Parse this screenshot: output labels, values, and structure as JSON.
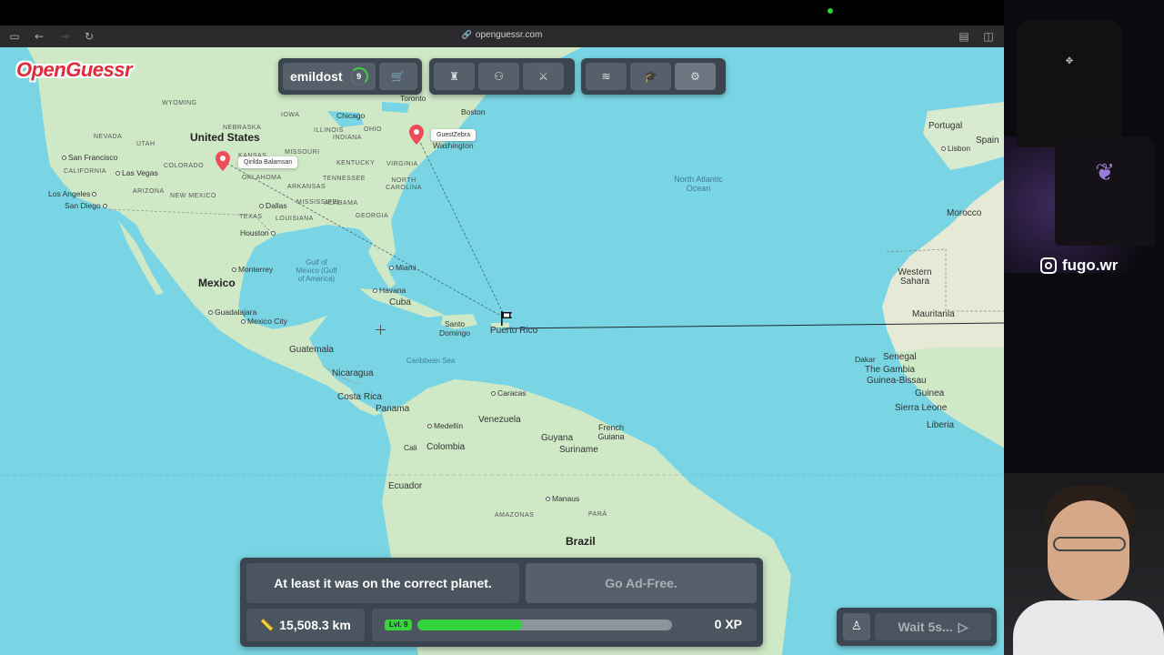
{
  "browser": {
    "url": "openguessr.com"
  },
  "logo": "OpenGuessr",
  "topbar": {
    "username": "emildost",
    "level": "9"
  },
  "map": {
    "countries": [
      "United States",
      "Mexico",
      "Cuba",
      "Guatemala",
      "Nicaragua",
      "Costa Rica",
      "Panama",
      "Venezuela",
      "Colombia",
      "Ecuador",
      "Guyana",
      "Suriname",
      "Brazil",
      "Portugal",
      "Spain",
      "Morocco",
      "Western Sahara",
      "Mauritania",
      "Senegal",
      "The Gambia",
      "Guinea-Bissau",
      "Guinea",
      "Sierra Leone",
      "Liberia"
    ],
    "labels": {
      "united_states": "United States",
      "mexico": "Mexico",
      "cuba": "Cuba",
      "guatemala": "Guatemala",
      "nicaragua": "Nicaragua",
      "costa_rica": "Costa Rica",
      "panama": "Panama",
      "venezuela": "Venezuela",
      "colombia": "Colombia",
      "ecuador": "Ecuador",
      "guyana": "Guyana",
      "suriname": "Suriname",
      "french_guiana": "French Guiana",
      "brazil": "Brazil",
      "portugal": "Portugal",
      "spain": "Spain",
      "morocco": "Morocco",
      "western_sahara": "Western Sahara",
      "mauritania": "Mauritania",
      "senegal": "Senegal",
      "gambia": "The Gambia",
      "guinea_bissau": "Guinea-Bissau",
      "guinea": "Guinea",
      "sierra_leone": "Sierra Leone",
      "liberia": "Liberia",
      "puerto_rico": "Puerto Rico",
      "santo_domingo": "Santo Domingo",
      "washington": "Washington",
      "boston": "Boston",
      "toronto": "Toronto",
      "chicago": "Chicago",
      "san_francisco": "San Francisco",
      "las_vegas": "Las Vegas",
      "los_angeles": "Los Angeles",
      "san_diego": "San Diego",
      "dallas": "Dallas",
      "houston": "Houston",
      "monterrey": "Monterrey",
      "guadalajara": "Guadalajara",
      "mexico_city": "Mexico City",
      "miami": "Miami",
      "havana": "Havana",
      "caracas": "Caracas",
      "medellin": "Medellín",
      "cali": "Cali",
      "manaus": "Manaus",
      "lisbon": "Lisbon",
      "dakar": "Dakar",
      "gulf_mexico": "Gulf of Mexico (Gulf of America)",
      "caribbean": "Caribbean Sea",
      "atlantic": "North Atlantic Ocean",
      "nevada": "NEVADA",
      "utah": "UTAH",
      "colorado": "COLORADO",
      "arizona": "ARIZONA",
      "new_mexico": "NEW MEXICO",
      "texas": "TEXAS",
      "oklahoma": "OKLAHOMA",
      "kansas": "KANSAS",
      "nebraska": "NEBRASKA",
      "iowa": "IOWA",
      "missouri": "MISSOURI",
      "illinois": "ILLINOIS",
      "indiana": "INDIANA",
      "ohio": "OHIO",
      "kentucky": "KENTUCKY",
      "tennessee": "TENNESSEE",
      "arkansas": "ARKANSAS",
      "mississippi": "MISSISSIPPI",
      "alabama": "ALABAMA",
      "georgia": "GEORGIA",
      "virginia": "VIRGINIA",
      "north_carolina": "NORTH CAROLINA",
      "louisiana": "LOUISIANA",
      "wyoming": "WYOMING",
      "california": "CALIFORNIA",
      "amazonas": "AMAZONAS",
      "para": "PARÁ"
    },
    "players": [
      {
        "name": "Qirilda Balamsan"
      },
      {
        "name": "GuestZebra"
      }
    ]
  },
  "result": {
    "message": "At least it was on the correct planet.",
    "ad_free": "Go Ad-Free.",
    "distance": "15,508.3 km",
    "level_badge": "Lvl. 9",
    "xp_progress": 0.41,
    "xp": "0 XP"
  },
  "bottom_right": {
    "wait_label": "Wait 5s..."
  },
  "overlay": {
    "instagram": "fugo.wr"
  },
  "colors": {
    "water": "#79d5e3",
    "land": "#cfe8c6",
    "panel": "#3a4550",
    "accent_green": "#32d43a",
    "logo_red": "#e02b3a",
    "pin_red": "#ef4b5a"
  }
}
